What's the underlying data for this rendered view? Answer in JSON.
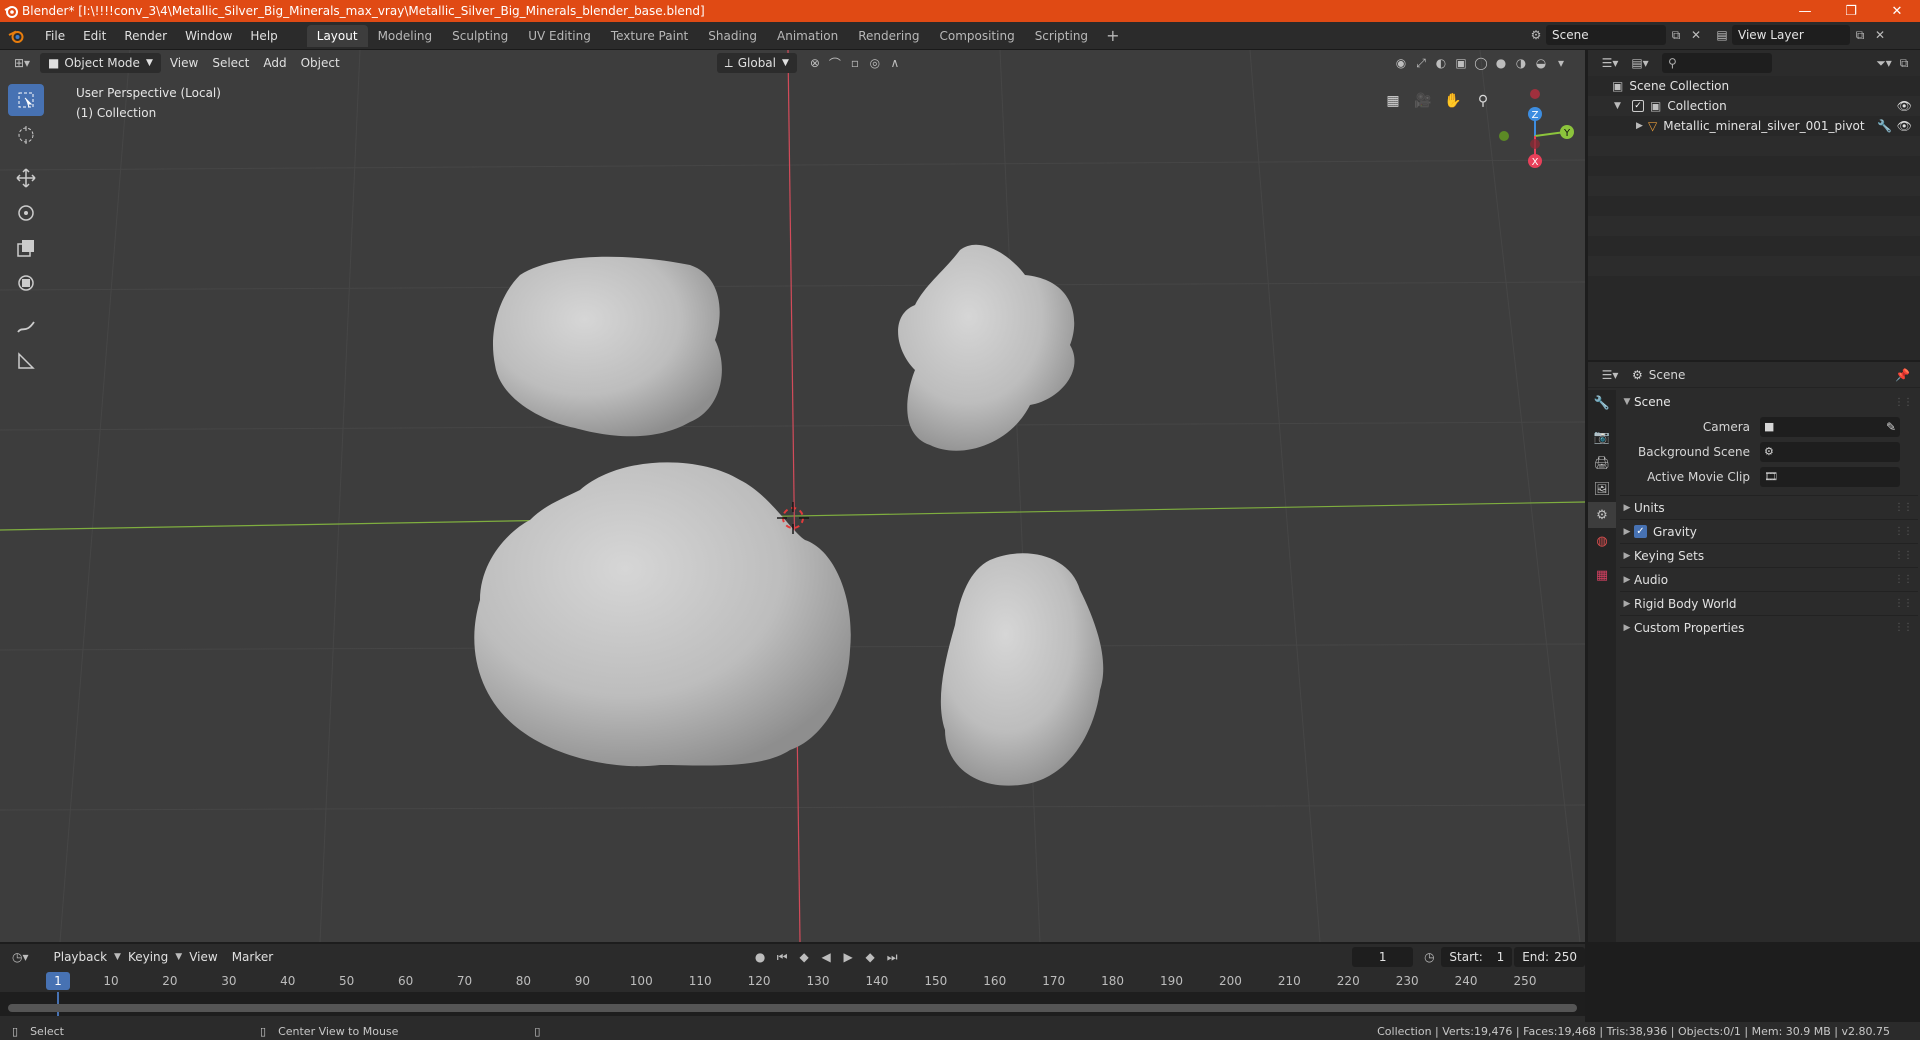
{
  "titlebar": {
    "title": "Blender* [I:\\!!!!conv_3\\4\\Metallic_Silver_Big_Minerals_max_vray\\Metallic_Silver_Big_Minerals_blender_base.blend]",
    "minimize": "—",
    "maximize": "❐",
    "close": "✕"
  },
  "menu": {
    "items": [
      "File",
      "Edit",
      "Render",
      "Window",
      "Help"
    ]
  },
  "workspaces": [
    "Layout",
    "Modeling",
    "Sculpting",
    "UV Editing",
    "Texture Paint",
    "Shading",
    "Animation",
    "Rendering",
    "Compositing",
    "Scripting"
  ],
  "workspace_add": "+",
  "scene_selector": {
    "scene": "Scene",
    "view_layer": "View Layer"
  },
  "viewport": {
    "mode": "Object Mode",
    "menus": [
      "View",
      "Select",
      "Add",
      "Object"
    ],
    "orientation": "Global",
    "info_line1": "User Perspective (Local)",
    "info_line2": "(1) Collection",
    "gizmo": {
      "x": "X",
      "y": "Y",
      "z": "Z"
    }
  },
  "outliner": {
    "search_placeholder": "",
    "scene_collection": "Scene Collection",
    "collection": "Collection",
    "object": "Metallic_mineral_silver_001_pivot"
  },
  "properties": {
    "context": "Scene",
    "panel_title": "Scene",
    "camera_label": "Camera",
    "background_scene_label": "Background Scene",
    "active_movie_clip_label": "Active Movie Clip",
    "subpanels": [
      "Units",
      "Gravity",
      "Keying Sets",
      "Audio",
      "Rigid Body World",
      "Custom Properties"
    ],
    "gravity_checked": true
  },
  "timeline": {
    "menus": [
      "Playback",
      "Keying",
      "View",
      "Marker"
    ],
    "current_frame": "1",
    "start_label": "Start:",
    "start_value": "1",
    "end_label": "End:",
    "end_value": "250",
    "ticks": [
      "1",
      "10",
      "20",
      "30",
      "40",
      "50",
      "60",
      "70",
      "80",
      "90",
      "100",
      "110",
      "120",
      "130",
      "140",
      "150",
      "160",
      "170",
      "180",
      "190",
      "200",
      "210",
      "220",
      "230",
      "240",
      "250"
    ]
  },
  "statusbar": {
    "left_action": "Select",
    "middle_action": "Center View to Mouse",
    "stats": "Collection | Verts:19,476 | Faces:19,468 | Tris:38,936 | Objects:0/1 | Mem: 30.9 MB | v2.80.75"
  },
  "colors": {
    "title_bar": "#e04a14",
    "accent_blue": "#4772b3",
    "axis_red": "#d34b5a",
    "axis_green": "#7fae3f",
    "gizmo_x": "#e8405a",
    "gizmo_y": "#8cc43c",
    "gizmo_z": "#3d8de0"
  },
  "icons": [
    "blender-logo-icon",
    "select-box-icon",
    "cursor-icon",
    "move-icon",
    "rotate-icon",
    "scale-icon",
    "transform-icon",
    "annotate-icon",
    "measure-icon",
    "grid-icon",
    "camera-icon",
    "hand-icon",
    "zoom-icon",
    "eye-icon",
    "filter-icon",
    "search-icon"
  ]
}
